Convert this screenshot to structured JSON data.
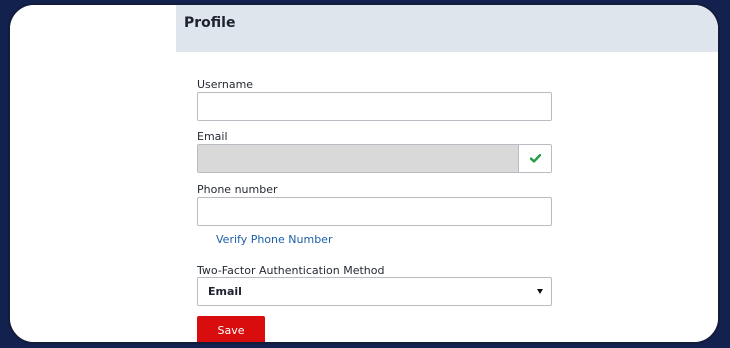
{
  "profile": {
    "title": "Profile",
    "username": {
      "label": "Username",
      "value": ""
    },
    "email": {
      "label": "Email",
      "value": "",
      "status_icon": "check-icon"
    },
    "phone": {
      "label": "Phone number",
      "value": "",
      "verify_link": "Verify Phone Number"
    },
    "two_factor": {
      "label": "Two-Factor Authentication Method",
      "selected": "Email"
    },
    "save_label": "Save"
  },
  "colors": {
    "accent": "#d90d0d",
    "link": "#1d5fa8",
    "header_bg": "#dfe5ed",
    "success": "#1e9e3e",
    "frame": "#13214f"
  }
}
